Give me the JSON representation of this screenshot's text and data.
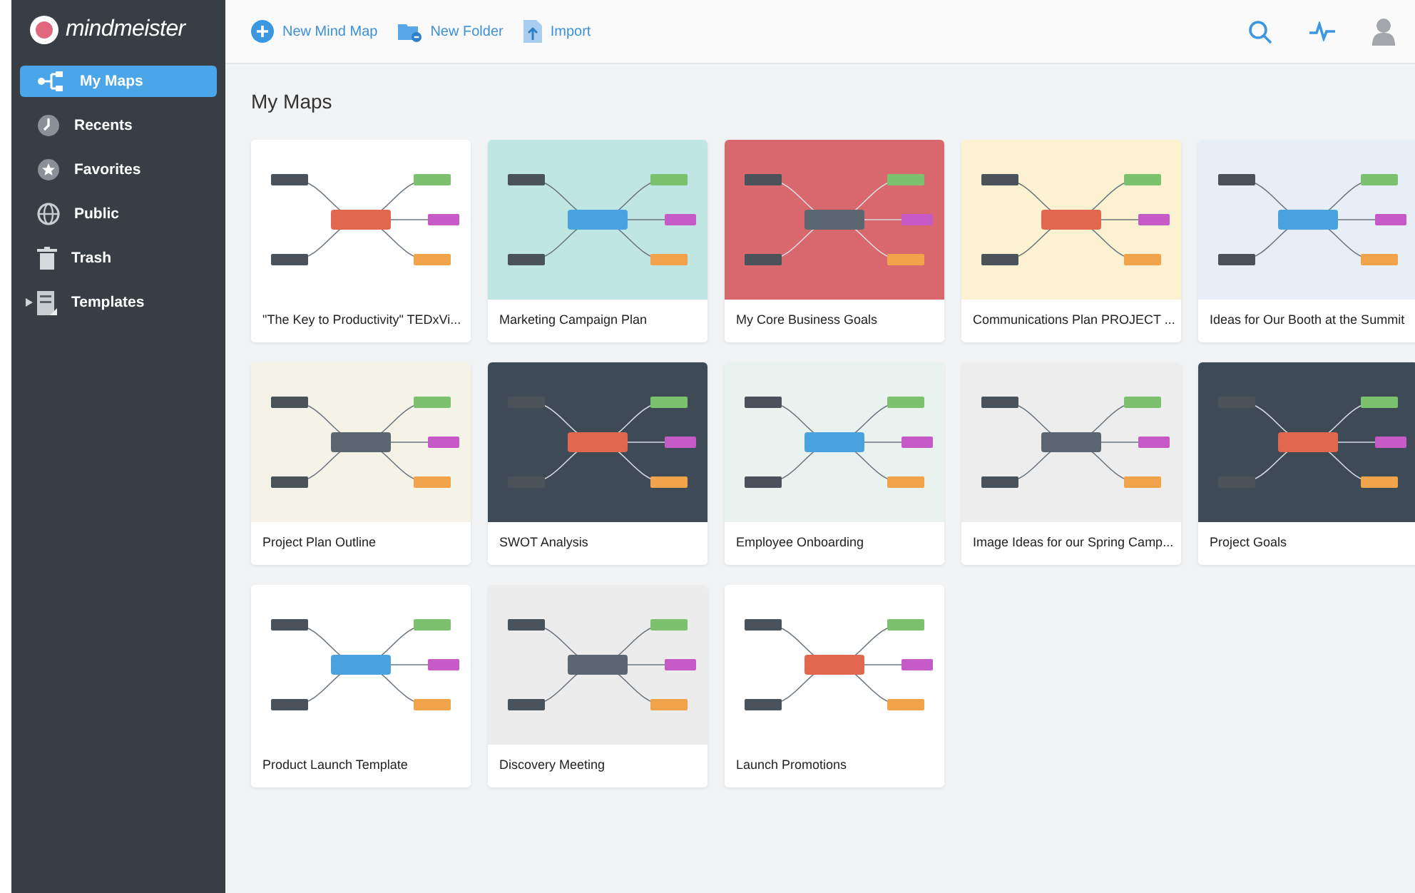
{
  "app": {
    "logo": "mindmeister"
  },
  "sidebar": {
    "items": [
      {
        "label": "My Maps",
        "selected": true
      },
      {
        "label": "Recents",
        "selected": false
      },
      {
        "label": "Favorites",
        "selected": false
      },
      {
        "label": "Public",
        "selected": false
      },
      {
        "label": "Trash",
        "selected": false
      },
      {
        "label": "Templates",
        "selected": false,
        "expanded": false
      }
    ]
  },
  "toolbar": {
    "actions": [
      "New Mind Map",
      "New Folder",
      "Import"
    ]
  },
  "page_title": "My Maps",
  "maps": [
    {
      "title": "\"The Key to Productivity\" TEDxVi...",
      "color": "#ffffff"
    },
    {
      "title": "Marketing Campaign Plan",
      "color": "#bfe6e2"
    },
    {
      "title": "My Core Business Goals",
      "color": "#d9676e"
    },
    {
      "title": "Communications Plan PROJECT ...",
      "color": "#fcf1d0"
    },
    {
      "title": "Ideas for Our Booth at the Summit",
      "color": "#e8eef6"
    },
    {
      "title": "Project Plan Outline",
      "color": "#f5f2e8"
    },
    {
      "title": "SWOT Analysis",
      "color": "#3e4a55"
    },
    {
      "title": "Employee Onboarding",
      "color": "#eaf2ef"
    },
    {
      "title": "Image Ideas for our Spring Camp...",
      "color": "#ededed"
    },
    {
      "title": "Project Goals",
      "color": "#3e4a55"
    },
    {
      "title": "Product Launch Template",
      "color": "#ffffff"
    },
    {
      "title": "Discovery Meeting",
      "color": "#ececec"
    },
    {
      "title": "Launch Promotions",
      "color": "#ffffff"
    }
  ]
}
